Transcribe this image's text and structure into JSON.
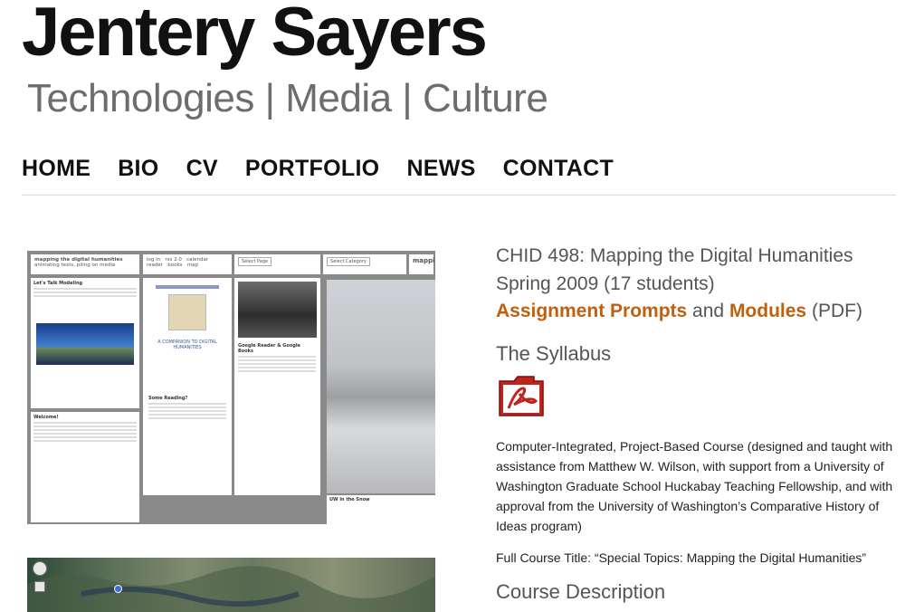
{
  "header": {
    "site_title": "Jentery Sayers",
    "tagline": "Technologies | Media | Culture"
  },
  "nav": {
    "items": [
      "HOME",
      "BIO",
      "CV",
      "PORTFOLIO",
      "NEWS",
      "CONTACT"
    ]
  },
  "screenshot": {
    "blog_title": "mapping the digital humanities",
    "blog_subtitle": "animating texts, piling on media",
    "top_links": [
      "log in",
      "rss 2.0",
      "calendar",
      "reader",
      "books",
      "map"
    ],
    "select_page": "Select Page",
    "select_category": "Select Category",
    "search_term": "mapping",
    "post1_title": "Let's Talk Modeling",
    "post2_title": "Welcome!",
    "post3_title": "Some Reading?",
    "post4_title": "Google Reader & Google Books",
    "photo_caption": "UW in the Snow",
    "book_label": "A COMPANION TO DIGITAL HUMANITIES"
  },
  "course": {
    "title": "CHID 498: Mapping the Digital Humanities",
    "term": "Spring 2009 (17 students)",
    "assignment_link": "Assignment Prompts",
    "and_text": "and",
    "modules_link": "Modules",
    "pdf_text": "(PDF)",
    "syllabus_heading": "The Syllabus",
    "description": "Computer-Integrated, Project-Based Course (designed and taught with assistance from Matthew W. Wilson, with support from a University of Washington Graduate School Huckabay Teaching Fellowship, and with approval from the University of Washington’s Comparative History of Ideas program)",
    "full_title": "Full Course Title: “Special Topics: Mapping the Digital Humanities”",
    "description_heading": "Course Description"
  },
  "colors": {
    "accent": "#c0600e",
    "heading_gray": "#555555"
  }
}
